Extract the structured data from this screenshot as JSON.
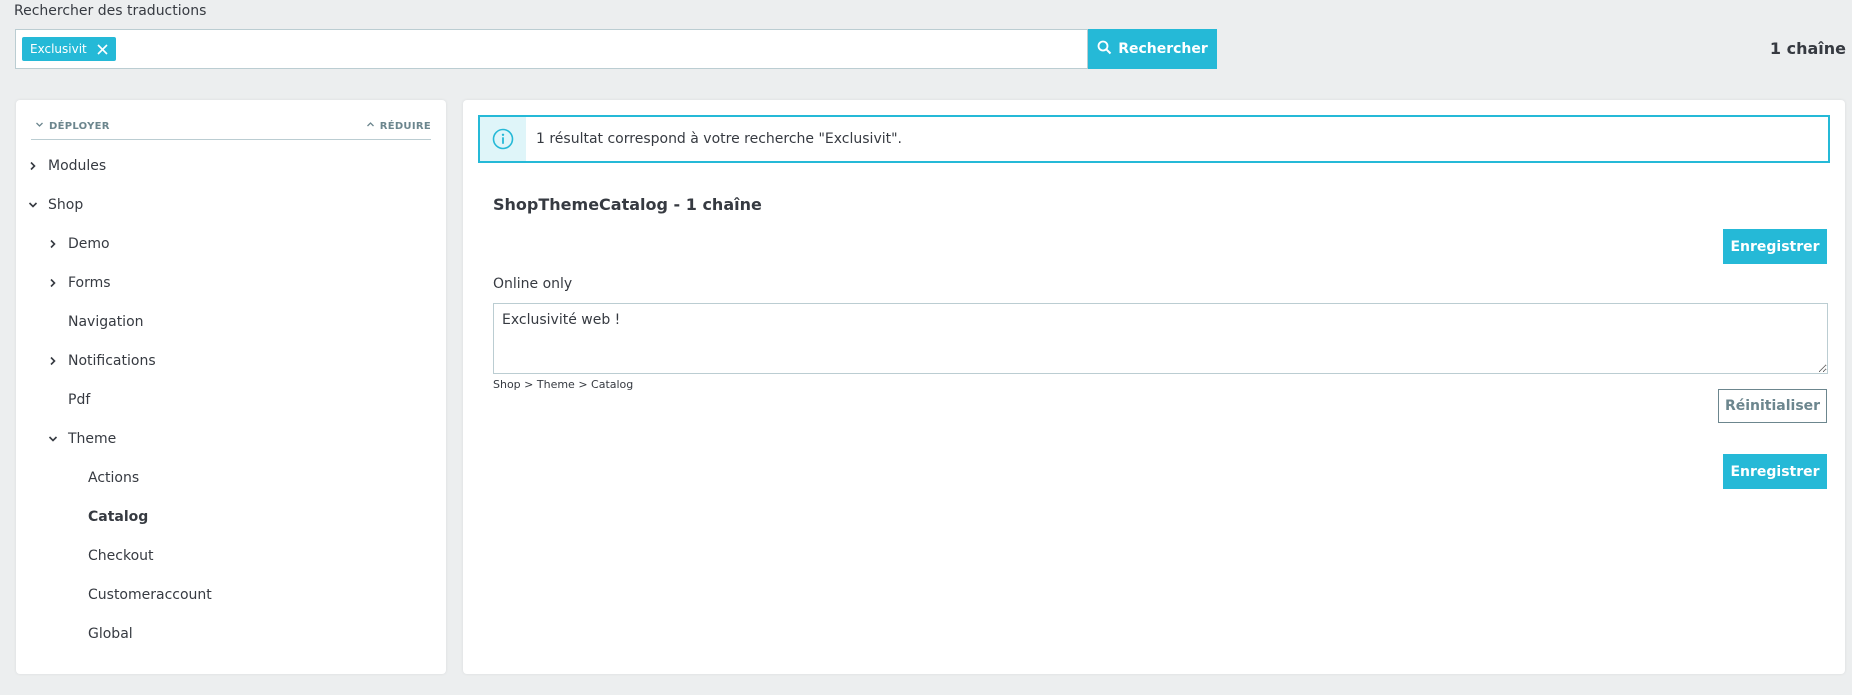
{
  "search": {
    "label": "Rechercher des traductions",
    "tag": "Exclusivit",
    "button_label": "Rechercher",
    "count": "1 chaîne"
  },
  "tree": {
    "expand_label": "DÉPLOYER",
    "collapse_label": "RÉDUIRE",
    "items": [
      {
        "label": "Modules",
        "level": 0,
        "chevron": "right"
      },
      {
        "label": "Shop",
        "level": 0,
        "chevron": "down"
      },
      {
        "label": "Demo",
        "level": 1,
        "chevron": "right"
      },
      {
        "label": "Forms",
        "level": 1,
        "chevron": "right"
      },
      {
        "label": "Navigation",
        "level": 1,
        "chevron": "none"
      },
      {
        "label": "Notifications",
        "level": 1,
        "chevron": "right"
      },
      {
        "label": "Pdf",
        "level": 1,
        "chevron": "none"
      },
      {
        "label": "Theme",
        "level": 1,
        "chevron": "down"
      },
      {
        "label": "Actions",
        "level": 2,
        "chevron": "none"
      },
      {
        "label": "Catalog",
        "level": 2,
        "chevron": "none",
        "active": true
      },
      {
        "label": "Checkout",
        "level": 2,
        "chevron": "none"
      },
      {
        "label": "Customeraccount",
        "level": 2,
        "chevron": "none"
      },
      {
        "label": "Global",
        "level": 2,
        "chevron": "none"
      }
    ]
  },
  "results": {
    "alert_text": "1 résultat correspond à votre recherche \"Exclusivit\".",
    "section_title": "ShopThemeCatalog - 1 chaîne",
    "save_label": "Enregistrer",
    "field_label": "Online only",
    "translation_value": "Exclusivité web !",
    "path": "Shop > Theme > Catalog",
    "reset_label": "Réinitialiser"
  },
  "colors": {
    "accent": "#25b9d7",
    "border": "#bbcdd2",
    "text": "#363a41",
    "muted": "#6c868e",
    "background": "#eceeef"
  }
}
